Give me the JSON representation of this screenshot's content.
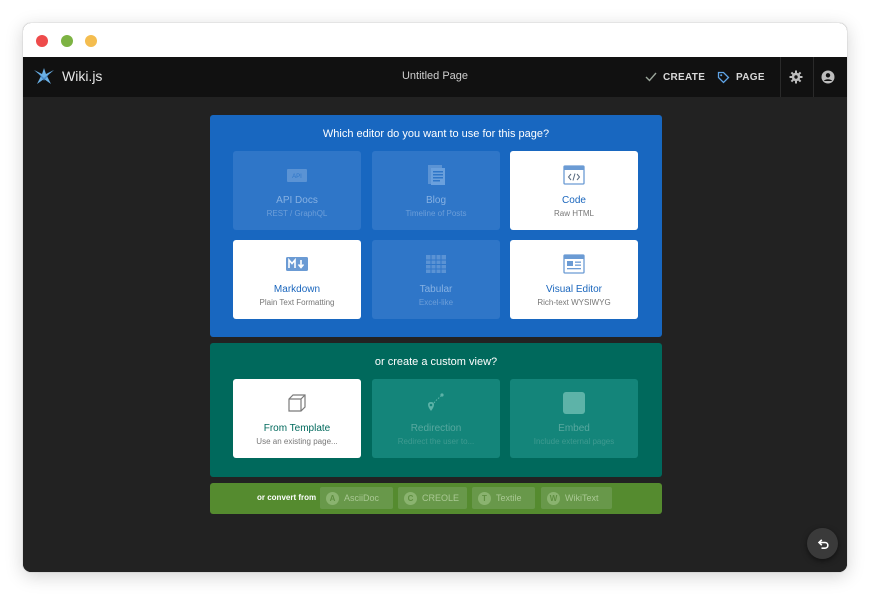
{
  "app": {
    "brand": "Wiki.js",
    "page_title": "Untitled Page",
    "nav": {
      "create_label": "CREATE",
      "page_label": "PAGE"
    }
  },
  "editor_panel": {
    "title": "Which editor do you want to use for this page?",
    "cards": [
      {
        "title": "API Docs",
        "subtitle": "REST / GraphQL",
        "icon": "api-icon",
        "state": "disabled"
      },
      {
        "title": "Blog",
        "subtitle": "Timeline of Posts",
        "icon": "blog-icon",
        "state": "disabled"
      },
      {
        "title": "Code",
        "subtitle": "Raw HTML",
        "icon": "code-icon",
        "state": "enabled"
      },
      {
        "title": "Markdown",
        "subtitle": "Plain Text Formatting",
        "icon": "markdown-icon",
        "state": "enabled"
      },
      {
        "title": "Tabular",
        "subtitle": "Excel-like",
        "icon": "table-icon",
        "state": "disabled"
      },
      {
        "title": "Visual Editor",
        "subtitle": "Rich-text WYSIWYG",
        "icon": "visual-editor-icon",
        "state": "enabled"
      }
    ]
  },
  "custom_panel": {
    "title": "or create a custom view?",
    "cards": [
      {
        "title": "From Template",
        "subtitle": "Use an existing page...",
        "icon": "template-cube-icon",
        "state": "enabled"
      },
      {
        "title": "Redirection",
        "subtitle": "Redirect the user to...",
        "icon": "redirect-icon",
        "state": "disabled"
      },
      {
        "title": "Embed",
        "subtitle": "Include external pages",
        "icon": "embed-icon",
        "state": "disabled"
      }
    ]
  },
  "convert_panel": {
    "label": "or convert from",
    "sources": [
      {
        "name": "AsciiDoc",
        "icon_letter": "A"
      },
      {
        "name": "CREOLE",
        "icon_letter": "C"
      },
      {
        "name": "Textile",
        "icon_letter": "T"
      },
      {
        "name": "WikiText",
        "icon_letter": "W"
      }
    ]
  },
  "colors": {
    "editor_panel_bg": "#1867c0",
    "custom_panel_bg": "#00695c",
    "convert_panel_bg": "#558b2f",
    "appbar_bg": "#111111",
    "content_bg": "#222222"
  }
}
